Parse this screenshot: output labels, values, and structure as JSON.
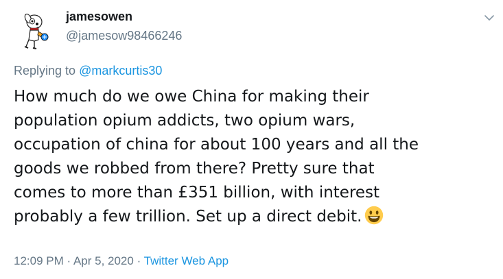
{
  "author": {
    "display_name": "jamesowen",
    "handle": "@jamesow98466246",
    "avatar_icon": "cartoon-dog-avatar-icon"
  },
  "menu": {
    "icon": "chevron-down-icon"
  },
  "reply": {
    "prefix": "Replying to ",
    "to_handle": "@markcurtis30"
  },
  "tweet": {
    "lines": [
      "How much do we owe China for making their",
      "population opium addicts, two opium wars,",
      "occupation of china for about 100 years and all the",
      "goods we robbed from there? Pretty sure that",
      "comes to more than £351 billion, with interest",
      "probably a few trillion. Set up a direct debit."
    ],
    "emoji": "smiling-face-emoji"
  },
  "meta": {
    "time": "12:09 PM",
    "sep1": " · ",
    "date": "Apr 5, 2020",
    "sep2": " · ",
    "source": "Twitter Web App"
  },
  "colors": {
    "link": "#1b95e0",
    "secondary_text": "#657786",
    "primary_text": "#14171a",
    "emoji_face": "#ffcc4d"
  }
}
